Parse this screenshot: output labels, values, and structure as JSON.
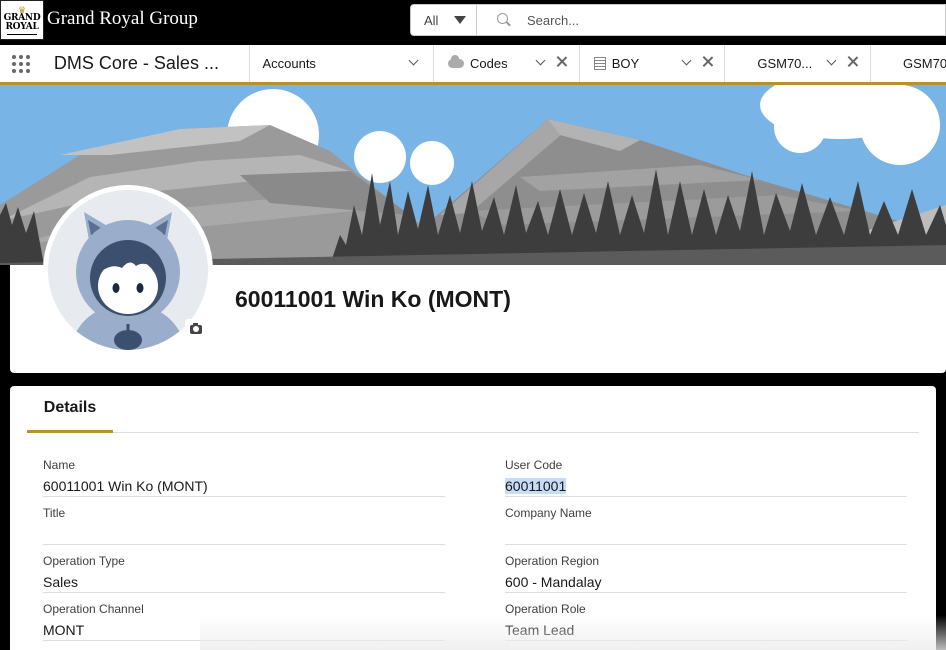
{
  "header": {
    "logo_line1": "GRAND",
    "logo_line2": "ROYAL",
    "brand": "Grand Royal Group",
    "search_scope": "All",
    "search_placeholder": "Search..."
  },
  "nav": {
    "app_name": "DMS Core - Sales ...",
    "tabs": [
      {
        "label": "Accounts"
      },
      {
        "label": "Codes"
      },
      {
        "label": "BOY"
      },
      {
        "label": "GSM70..."
      },
      {
        "label": "GSM70"
      }
    ]
  },
  "record": {
    "title": "60011001 Win Ko (MONT)"
  },
  "details": {
    "tab_label": "Details",
    "fields": [
      {
        "label": "Name",
        "value": "60011001 Win Ko (MONT)"
      },
      {
        "label": "User Code",
        "value": "60011001"
      },
      {
        "label": "Title",
        "value": ""
      },
      {
        "label": "Company Name",
        "value": ""
      },
      {
        "label": "Operation Type",
        "value": "Sales"
      },
      {
        "label": "Operation Region",
        "value": "600 - Mandalay"
      },
      {
        "label": "Operation Channel",
        "value": "MONT"
      },
      {
        "label": "Operation Role",
        "value": "Team Lead"
      }
    ]
  },
  "colors": {
    "accent_gold": "#b8912f",
    "header_bg": "#000000",
    "sky": "#78b4e6",
    "selection": "#c8dcf7"
  }
}
